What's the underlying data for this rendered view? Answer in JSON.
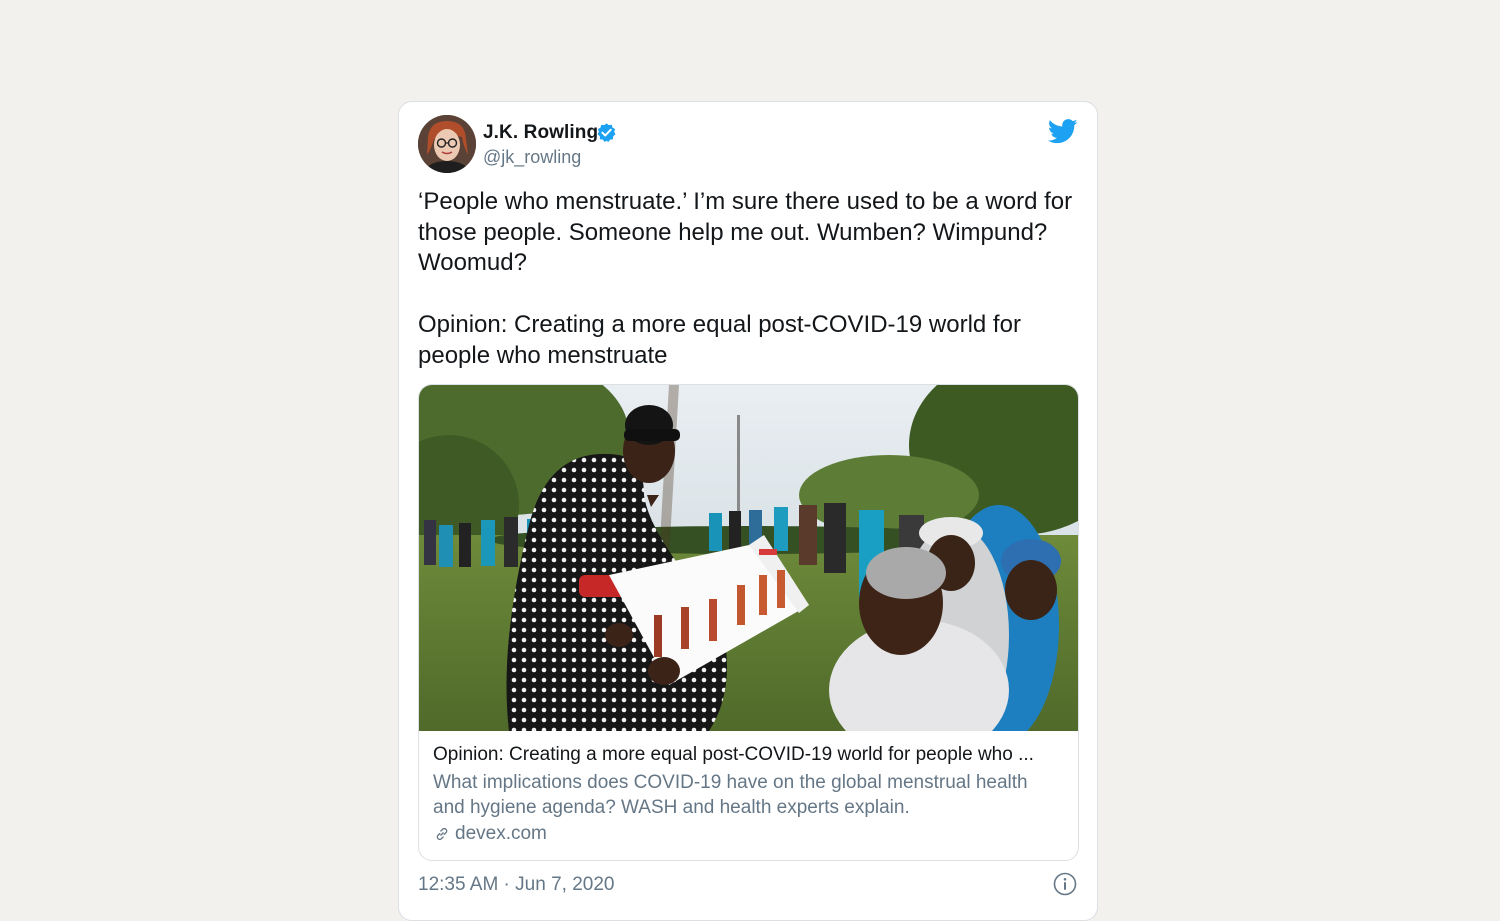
{
  "author": {
    "name": "J.K. Rowling",
    "handle": "@jk_rowling",
    "verified": true
  },
  "tweet": {
    "paragraphs": [
      "‘People who menstruate.’ I’m sure there used to be a word for those people. Someone help me out. Wumben? Wimpund? Woomud?",
      "Opinion: Creating a more equal post-COVID-19 world for people who menstruate"
    ],
    "timestamp": "12:35 AM · Jun 7, 2020"
  },
  "link_card": {
    "title": "Opinion: Creating a more equal post-COVID-19 world for people who ...",
    "description": "What implications does COVID-19 have on the global menstrual health and hygiene agenda? WASH and health experts explain.",
    "domain": "devex.com"
  },
  "icons": {
    "brand": "twitter-bird-icon",
    "verified": "verified-badge-icon",
    "link": "link-icon",
    "info": "info-icon"
  },
  "colors": {
    "background": "#f2f1ee",
    "card": "#ffffff",
    "text": "#14171a",
    "muted": "#657786",
    "twitter_blue": "#1da1f2",
    "border": "#dcdfe3"
  }
}
